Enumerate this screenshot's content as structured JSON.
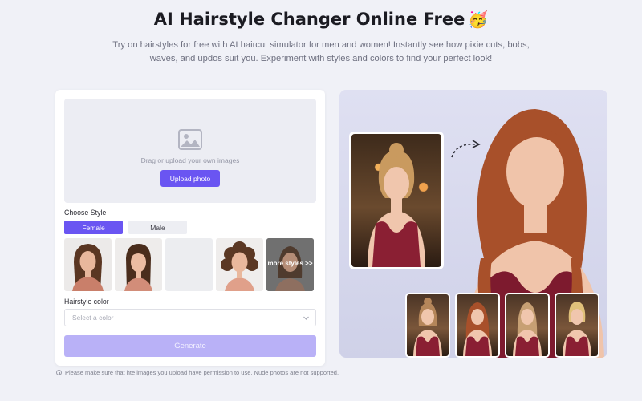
{
  "header": {
    "title": "AI Hairstyle Changer Online Free",
    "title_emoji": "🥳",
    "subtitle": "Try on hairstyles for free with AI haircut simulator for men and women! Instantly see how pixie cuts, bobs, waves, and updos suit you. Experiment with styles and colors to find your perfect look!"
  },
  "upload": {
    "icon": "image-icon",
    "hint": "Drag or upload your own images",
    "button_label": "Upload photo"
  },
  "style": {
    "label": "Choose Style",
    "tabs": [
      {
        "label": "Female",
        "active": true
      },
      {
        "label": "Male",
        "active": false
      }
    ],
    "more_label": "more styles >>"
  },
  "color": {
    "label": "Hairstyle color",
    "placeholder": "Select a color"
  },
  "generate_label": "Generate",
  "notice": "Please make sure that hte images you upload have permission to use. Nude photos are not supported.",
  "colors": {
    "accent": "#6a55f2",
    "generate_disabled": "#b9b1f7",
    "background": "#f0f1f7"
  }
}
